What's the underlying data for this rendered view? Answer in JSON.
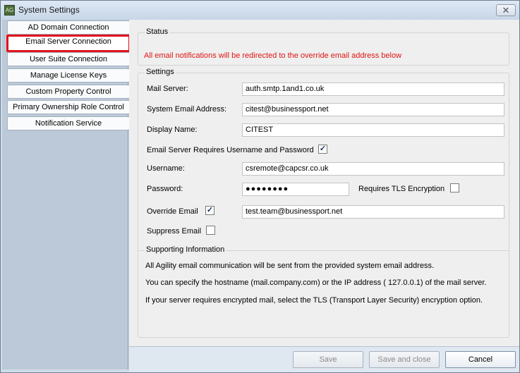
{
  "window": {
    "title": "System Settings",
    "icon": "agility-app-icon",
    "close_glyph": "✕",
    "app_icon_text": "AG"
  },
  "sidebar": {
    "items": [
      {
        "label": "AD Domain Connection"
      },
      {
        "label": "Email Server Connection",
        "selected": true
      },
      {
        "label": "User Suite Connection"
      },
      {
        "label": "Manage License Keys"
      },
      {
        "label": "Custom Property Control"
      },
      {
        "label": "Primary Ownership Role Control"
      },
      {
        "label": "Notification Service"
      }
    ]
  },
  "status": {
    "title": "Status",
    "message": "All email notifications will be redirected to the override email address below",
    "message_color": "#e01414"
  },
  "settings": {
    "title": "Settings",
    "mail_server": {
      "label": "Mail Server:",
      "value": "auth.smtp.1and1.co.uk"
    },
    "system_email": {
      "label": "System Email Address:",
      "value": "citest@businessport.net"
    },
    "display_name": {
      "label": "Display Name:",
      "value": "CITEST"
    },
    "requires_auth": {
      "label": "Email Server Requires Username and Password",
      "checked": true
    },
    "username": {
      "label": "Username:",
      "value": "csremote@capcsr.co.uk"
    },
    "password": {
      "label": "Password:",
      "value": "●●●●●●●●"
    },
    "tls": {
      "label": "Requires TLS Encryption",
      "checked": false
    },
    "override_email": {
      "label": "Override Email",
      "checked": true,
      "value": "test.team@businessport.net"
    },
    "suppress_email": {
      "label": "Suppress Email",
      "checked": false
    },
    "check_glyph": "✓"
  },
  "supporting": {
    "title": "Supporting Information",
    "lines": [
      "All Agility email communication will be sent from the provided system email address.",
      "You can specify the hostname (mail.company.com) or the IP address ( 127.0.0.1) of the mail server.",
      "If your server requires encrypted mail, select the TLS (Transport Layer Security) encryption option."
    ]
  },
  "footer": {
    "save": "Save",
    "save_close": "Save and close",
    "cancel": "Cancel"
  }
}
